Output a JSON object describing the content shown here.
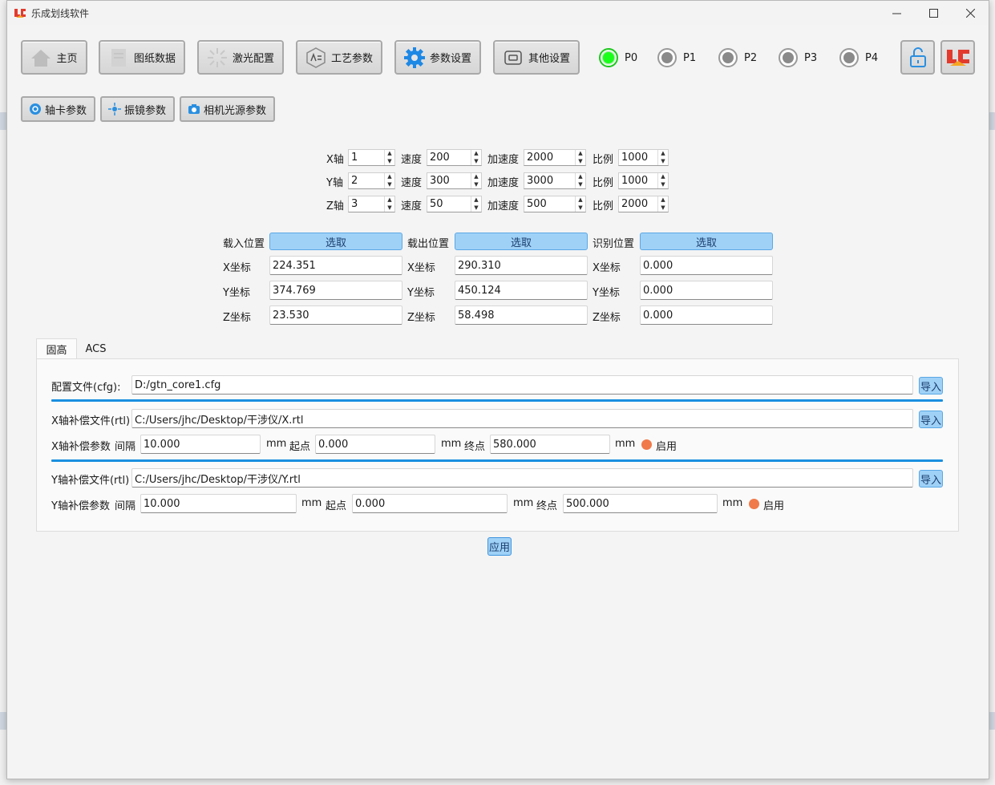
{
  "window": {
    "title": "乐成划线软件"
  },
  "toolbar": {
    "home": "主页",
    "drawing": "图纸数据",
    "laser": "激光配置",
    "process": "工艺参数",
    "params": "参数设置",
    "other": "其他设置"
  },
  "ports": [
    "P0",
    "P1",
    "P2",
    "P3",
    "P4"
  ],
  "subtabs": {
    "axis_card": "轴卡参数",
    "galvo": "振镜参数",
    "camera": "相机光源参数"
  },
  "axes": {
    "speed_label": "速度",
    "accel_label": "加速度",
    "ratio_label": "比例",
    "rows": [
      {
        "label": "X轴",
        "axis": "1",
        "speed": "200",
        "accel": "2000",
        "ratio": "1000"
      },
      {
        "label": "Y轴",
        "axis": "2",
        "speed": "300",
        "accel": "3000",
        "ratio": "1000"
      },
      {
        "label": "Z轴",
        "axis": "3",
        "speed": "50",
        "accel": "500",
        "ratio": "2000"
      }
    ]
  },
  "positions": {
    "pick_label": "选取",
    "x_label": "X坐标",
    "y_label": "Y坐标",
    "z_label": "Z坐标",
    "groups": [
      {
        "title": "载入位置",
        "x": "224.351",
        "y": "374.769",
        "z": "23.530"
      },
      {
        "title": "载出位置",
        "x": "290.310",
        "y": "450.124",
        "z": "58.498"
      },
      {
        "title": "识别位置",
        "x": "0.000",
        "y": "0.000",
        "z": "0.000"
      }
    ]
  },
  "tabs": [
    "固高",
    "ACS"
  ],
  "config": {
    "cfg_label": "配置文件(cfg):",
    "cfg_value": "D:/gtn_core1.cfg",
    "import_label": "导入",
    "x_file_label": "X轴补偿文件(rtl)",
    "x_file_value": "C:/Users/jhc/Desktop/干涉仪/X.rtl",
    "x_param_label": "X轴补偿参数",
    "y_file_label": "Y轴补偿文件(rtl)",
    "y_file_value": "C:/Users/jhc/Desktop/干涉仪/Y.rtl",
    "y_param_label": "Y轴补偿参数",
    "interval_label": "间隔",
    "start_label": "起点",
    "end_label": "终点",
    "unit": "mm",
    "enable_label": "启用",
    "x_interval": "10.000",
    "x_start": "0.000",
    "x_end": "580.000",
    "y_interval": "10.000",
    "y_start": "0.000",
    "y_end": "500.000"
  },
  "apply_label": "应用",
  "colors": {
    "accent": "#1a8fe0",
    "button_blue": "#9fd1f7",
    "enable_dot": "#f07a4a",
    "active_port": "#1aff1a"
  }
}
